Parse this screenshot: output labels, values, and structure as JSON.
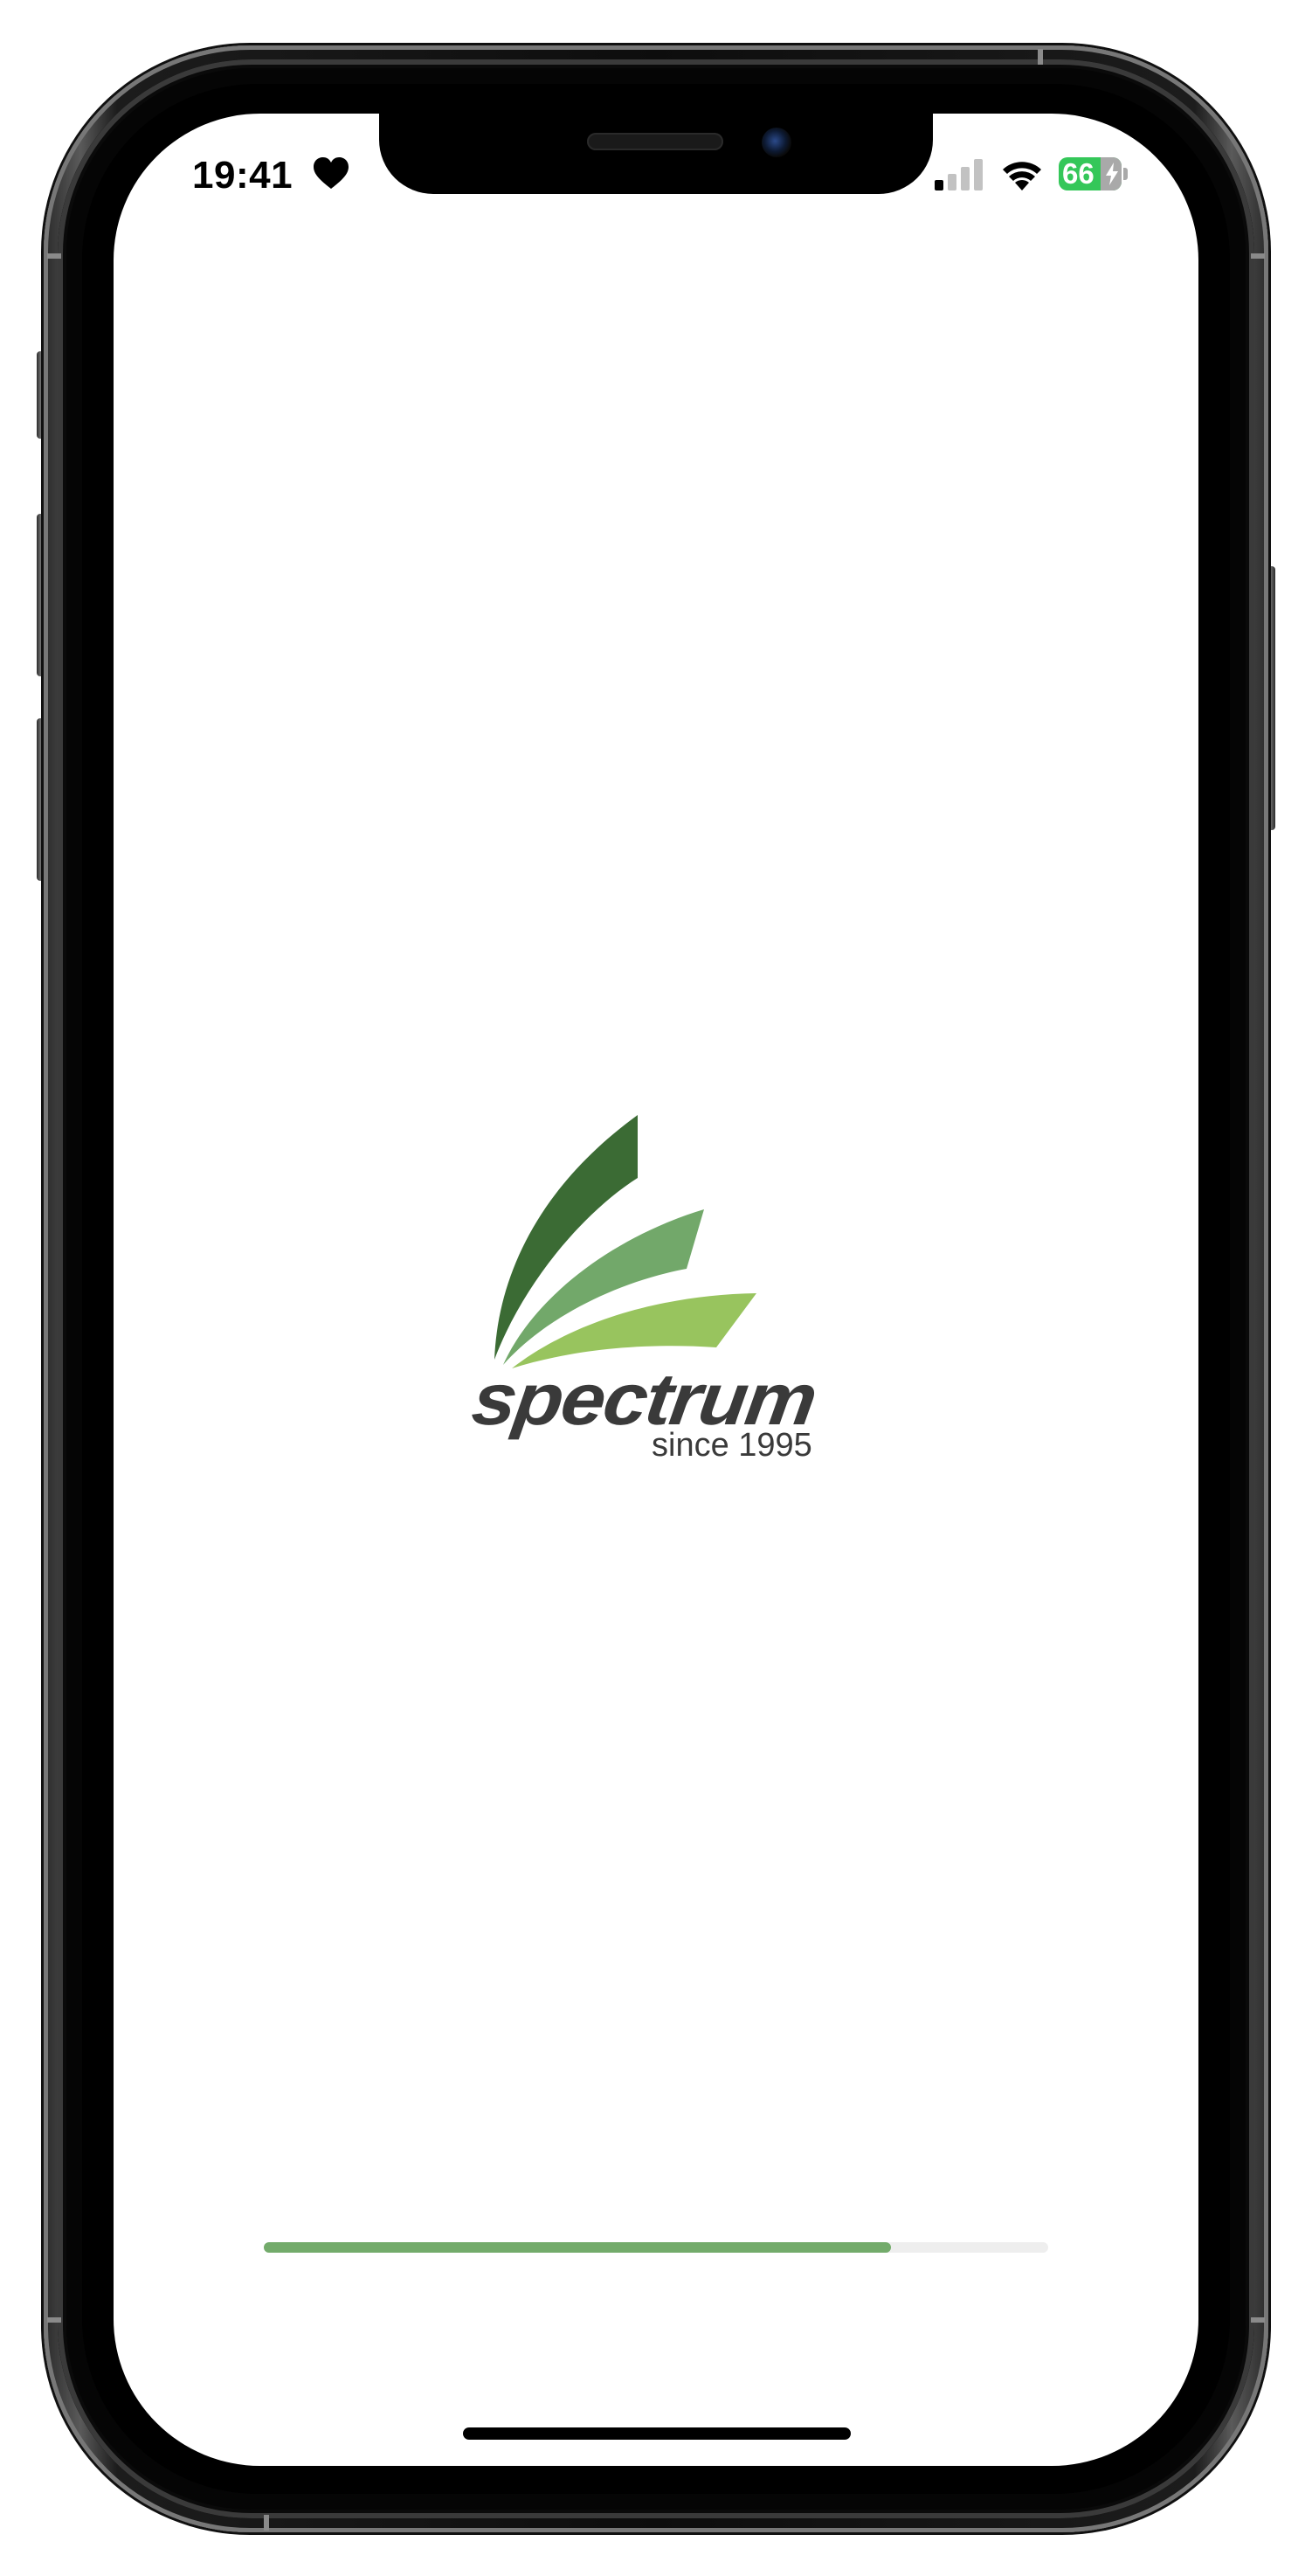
{
  "status_bar": {
    "time": "19:41",
    "heart_icon": "heart-icon",
    "signal_icon": "cellular-signal-icon",
    "signal_bars_active": 1,
    "signal_bars_total": 4,
    "wifi_icon": "wifi-icon",
    "battery_level": "66",
    "battery_charging": true,
    "battery_color": "#34c759"
  },
  "splash": {
    "brand_name": "spectrum",
    "tagline": "since 1995",
    "logo_colors": {
      "dark": "#3b6b34",
      "mid": "#72a86a",
      "light": "#98c45e",
      "text": "#3a3a3a"
    }
  },
  "loader": {
    "progress_fraction": 0.8,
    "fill_color": "#73ab6b",
    "track_color": "#eeeeee"
  }
}
